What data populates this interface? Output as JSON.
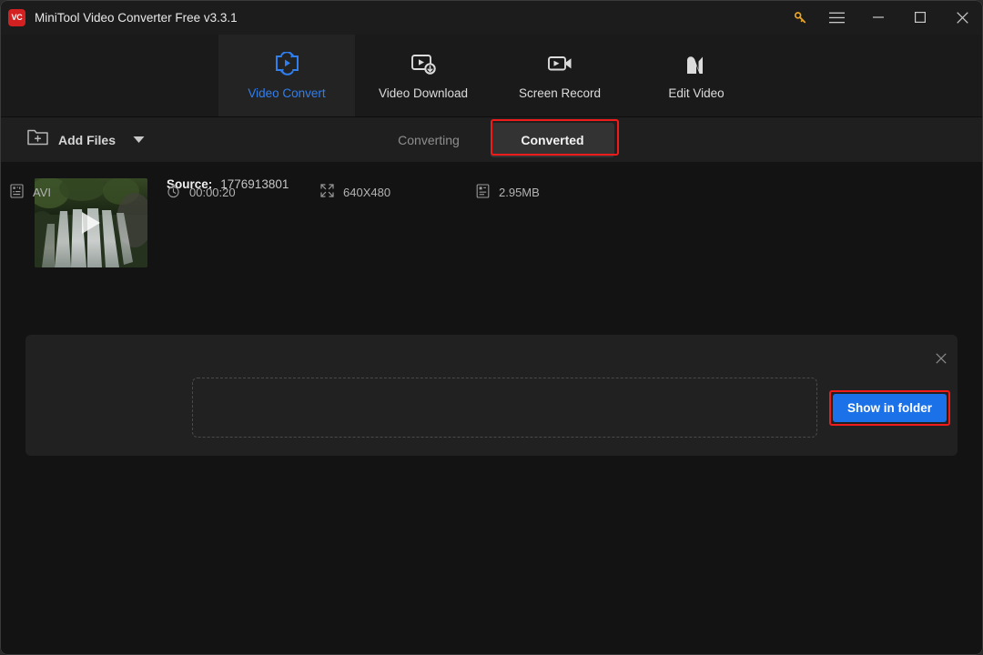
{
  "window": {
    "title": "MiniTool Video Converter Free v3.3.1",
    "logo_text": "VC",
    "logo_color": "#d32020",
    "accent_color": "#2f7ff0",
    "button_color": "#1b72e8",
    "annotation_color": "#f01c1c"
  },
  "titlebar": {
    "controls": [
      {
        "name": "key-icon",
        "label": "Activate"
      },
      {
        "name": "hamburger-icon",
        "label": "Menu"
      },
      {
        "name": "minimize-icon",
        "label": "Minimize"
      },
      {
        "name": "maximize-icon",
        "label": "Maximize"
      },
      {
        "name": "close-icon",
        "label": "Close"
      }
    ]
  },
  "nav": {
    "tabs": [
      {
        "label": "Video Convert",
        "icon": "video-convert-icon",
        "active": true
      },
      {
        "label": "Video Download",
        "icon": "video-download-icon",
        "active": false
      },
      {
        "label": "Screen Record",
        "icon": "screen-record-icon",
        "active": false
      },
      {
        "label": "Edit Video",
        "icon": "edit-video-icon",
        "active": false
      }
    ]
  },
  "toolbar": {
    "add_files_label": "Add Files",
    "add_files_icon": "folder-plus-icon",
    "caret_icon": "chevron-down-icon",
    "segments": [
      {
        "label": "Converting",
        "active": false
      },
      {
        "label": "Converted",
        "active": true
      }
    ]
  },
  "card": {
    "source_label": "Source:",
    "source_value": "1776913801",
    "thumbnail_alt": "waterfall-video-thumbnail",
    "play_icon": "play-icon",
    "close_icon": "close-icon",
    "meta": [
      {
        "icon": "format-icon",
        "value": "AVI"
      },
      {
        "icon": "clock-icon",
        "value": "00:00:20"
      },
      {
        "icon": "resolution-icon",
        "value": "640X480"
      },
      {
        "icon": "filesize-icon",
        "value": "2.95MB"
      }
    ],
    "action_label": "Show in folder"
  }
}
